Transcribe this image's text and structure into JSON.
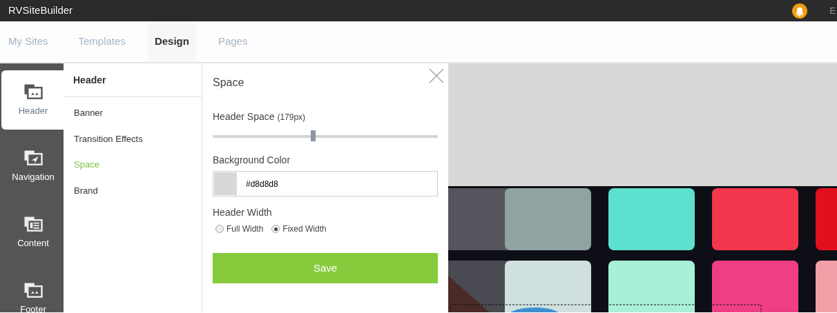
{
  "app": {
    "title": "RVSiteBuilder",
    "user_text": "E"
  },
  "tabs": [
    {
      "label": "My Sites",
      "selected": false
    },
    {
      "label": "Templates",
      "selected": false
    },
    {
      "label": "Design",
      "selected": true
    },
    {
      "label": "Pages",
      "selected": false
    }
  ],
  "sidebar": {
    "items": [
      {
        "label": "Header",
        "kind": "header",
        "selected": true
      },
      {
        "label": "Navigation",
        "kind": "navigation",
        "selected": false
      },
      {
        "label": "Content",
        "kind": "content",
        "selected": false
      },
      {
        "label": "Footer",
        "kind": "footer",
        "selected": false
      }
    ]
  },
  "submenu": {
    "title": "Header",
    "items": [
      {
        "label": "Banner",
        "selected": false
      },
      {
        "label": "Transition Effects",
        "selected": false
      },
      {
        "label": "Space",
        "selected": true
      },
      {
        "label": "Brand",
        "selected": false
      }
    ]
  },
  "panel": {
    "title": "Space",
    "header_space": {
      "label": "Header Space",
      "reading": "(179px)",
      "level": 0.446
    },
    "background_color": {
      "label": "Background Color",
      "value": "#d8d8d8"
    },
    "header_width": {
      "label": "Header Width",
      "options": [
        {
          "label": "Full Width",
          "selected": false
        },
        {
          "label": "Fixed Width",
          "selected": true
        }
      ]
    },
    "save": "Save"
  }
}
